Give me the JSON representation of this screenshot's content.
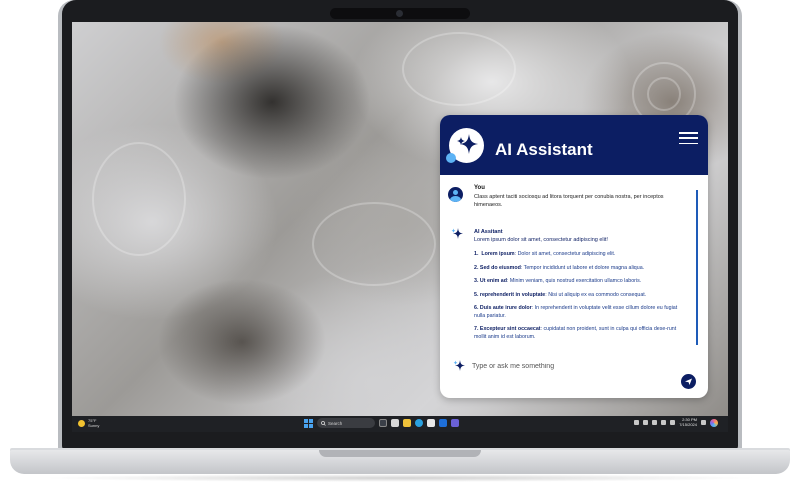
{
  "taskbar": {
    "weather_temp": "75°F",
    "weather_desc": "Sunny",
    "search_label": "Search",
    "clock_time": "2:30 PM",
    "clock_date": "7/15/2024"
  },
  "assistant": {
    "title": "AI Assistant",
    "user_name": "You",
    "user_message": "Class aptent taciti sociosqu ad litora torquent per conubia nostra, per inceptos himenaeos.",
    "ai_name": "AI Assitant",
    "ai_intro": "Lorem ipsum dolor sit amet, consectetur adipiscing elit!",
    "items": [
      {
        "num": "1.",
        "bold": "Lorem ipsum",
        "text": ": Dolor sit amet, consectetur adipiscing elit."
      },
      {
        "num": "2.",
        "bold": "Sed do eiusmod",
        "text": ": Tempor incididunt ut labore et dolore magna aliqua."
      },
      {
        "num": "3.",
        "bold": "Ut enim ad",
        "text": ": Minim veniam, quis nostrud exercitation ullamco laboris."
      },
      {
        "num": "5.",
        "bold": "reprehenderit in voluptate",
        "text": ": Nisi ut aliquip ex ea commodo consequat."
      },
      {
        "num": "6.",
        "bold": "Duis aute irure dolor",
        "text": ": In reprehenderit in voluptate velit esse cillum dolore eu fugiat nulla pariatur."
      },
      {
        "num": "7.",
        "bold": "Excepteur sint occaecat",
        "text": ": cupidatat non proident, sunt in culpa qui officia dese-runt mollit anim id est laborum."
      }
    ],
    "input_placeholder": "Type or ask me something"
  },
  "colors": {
    "header": "#0c1e63",
    "accent": "#5db3f5",
    "scrollbar": "#1e5bb8"
  },
  "icons": [
    "sparkle-icon",
    "menu-icon",
    "user-avatar-icon",
    "send-icon",
    "windows-start-icon",
    "search-icon",
    "sun-icon",
    "copilot-icon"
  ]
}
